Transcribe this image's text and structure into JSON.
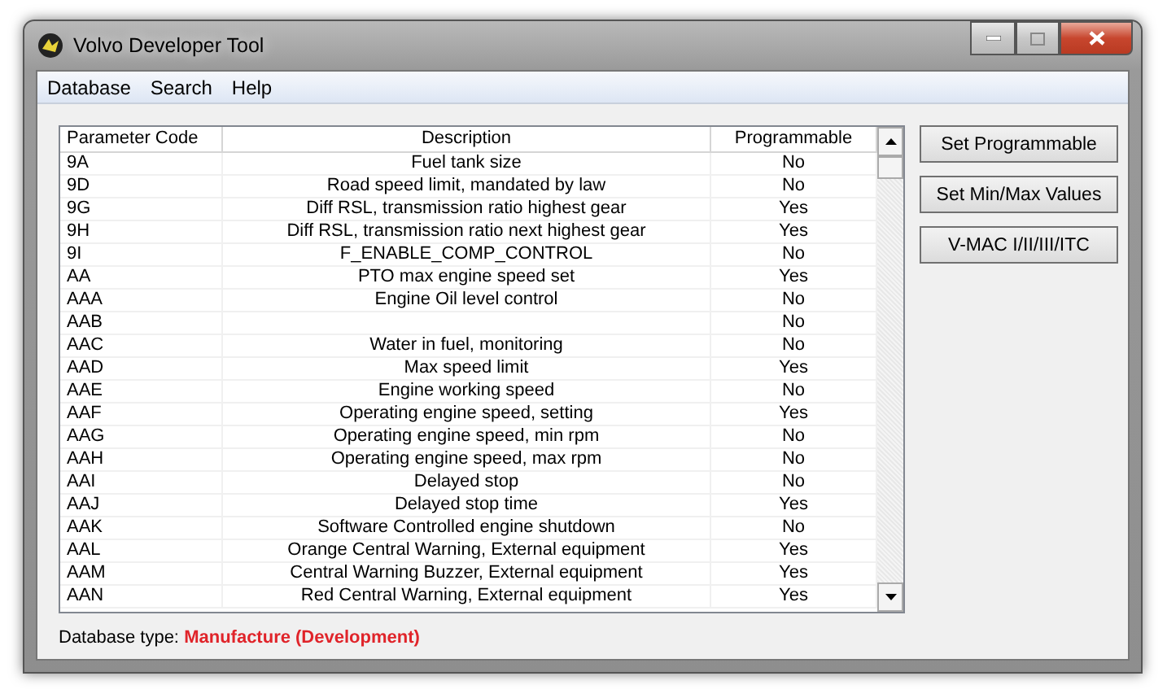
{
  "window": {
    "title": "Volvo Developer Tool"
  },
  "menu": [
    "Database",
    "Search",
    "Help"
  ],
  "table": {
    "columns": [
      "Parameter Code",
      "Description",
      "Programmable"
    ],
    "rows": [
      {
        "code": "9A",
        "description": "Fuel tank size",
        "programmable": "No"
      },
      {
        "code": "9D",
        "description": "Road speed limit, mandated by law",
        "programmable": "No"
      },
      {
        "code": "9G",
        "description": "Diff RSL, transmission ratio highest gear",
        "programmable": "Yes"
      },
      {
        "code": "9H",
        "description": "Diff RSL, transmission ratio next highest gear",
        "programmable": "Yes"
      },
      {
        "code": "9I",
        "description": "F_ENABLE_COMP_CONTROL",
        "programmable": "No"
      },
      {
        "code": "AA",
        "description": "PTO max engine speed set",
        "programmable": "Yes"
      },
      {
        "code": "AAA",
        "description": "Engine Oil level control",
        "programmable": "No"
      },
      {
        "code": "AAB",
        "description": "",
        "programmable": "No"
      },
      {
        "code": "AAC",
        "description": "Water in fuel, monitoring",
        "programmable": "No"
      },
      {
        "code": "AAD",
        "description": "Max speed limit",
        "programmable": "Yes"
      },
      {
        "code": "AAE",
        "description": "Engine working speed",
        "programmable": "No"
      },
      {
        "code": "AAF",
        "description": "Operating engine speed, setting",
        "programmable": "Yes"
      },
      {
        "code": "AAG",
        "description": "Operating engine speed, min rpm",
        "programmable": "No"
      },
      {
        "code": "AAH",
        "description": "Operating engine speed, max rpm",
        "programmable": "No"
      },
      {
        "code": "AAI",
        "description": "Delayed stop",
        "programmable": "No"
      },
      {
        "code": "AAJ",
        "description": "Delayed stop time",
        "programmable": "Yes"
      },
      {
        "code": "AAK",
        "description": "Software Controlled engine shutdown",
        "programmable": "No"
      },
      {
        "code": "AAL",
        "description": "Orange Central Warning, External equipment",
        "programmable": "Yes"
      },
      {
        "code": "AAM",
        "description": "Central Warning Buzzer, External equipment",
        "programmable": "Yes"
      },
      {
        "code": "AAN",
        "description": "Red Central Warning, External equipment",
        "programmable": "Yes"
      }
    ]
  },
  "buttons": [
    "Set Programmable",
    "Set Min/Max Values",
    "V-MAC I/II/III/ITC"
  ],
  "status": {
    "label": "Database type:",
    "value": "Manufacture (Development)"
  }
}
